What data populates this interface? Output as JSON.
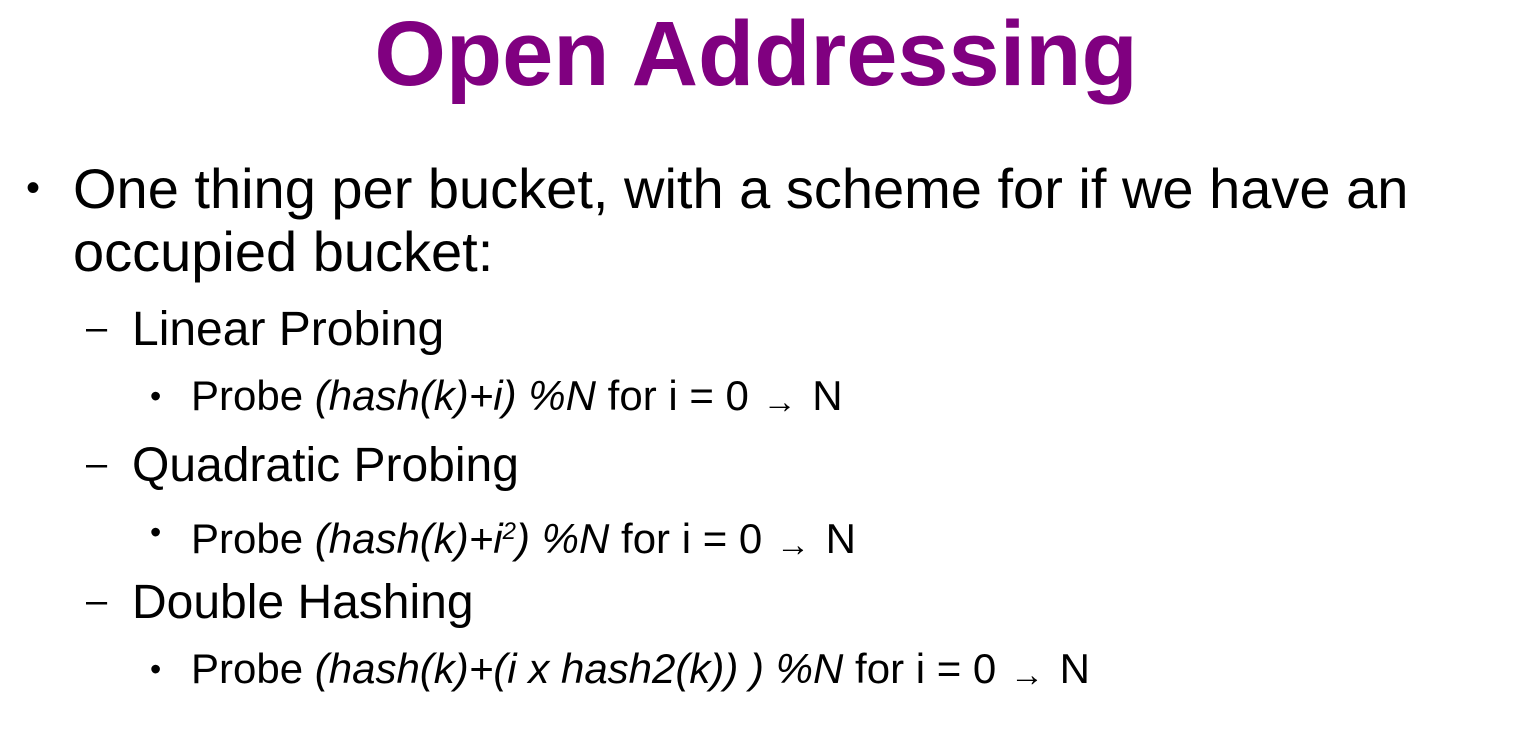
{
  "slide": {
    "title": "Open Addressing",
    "title_color": "#800080",
    "main_bullet": "One thing per bucket, with a scheme for if we have an occupied bucket:",
    "bullet_symbol": "•",
    "dash_symbol": "–",
    "arrow_symbol": "→",
    "items": [
      {
        "heading": "Linear Probing",
        "probe": {
          "prefix": "Probe ",
          "formula_a": "(hash(k)+i",
          "formula_sup": "",
          "formula_b": ") %N",
          "range_text": " for i = 0",
          "range_end": " N"
        }
      },
      {
        "heading": "Quadratic Probing",
        "probe": {
          "prefix": "Probe ",
          "formula_a": "(hash(k)+i",
          "formula_sup": "2",
          "formula_b": ") %N",
          "range_text": " for i = 0",
          "range_end": " N"
        }
      },
      {
        "heading": "Double Hashing",
        "probe": {
          "prefix": "Probe ",
          "formula_a": "(hash(k)+(i x hash2(k)) ",
          "formula_sup": "",
          "formula_b": ") %N",
          "range_text": " for i = 0",
          "range_end": " N"
        }
      }
    ]
  }
}
